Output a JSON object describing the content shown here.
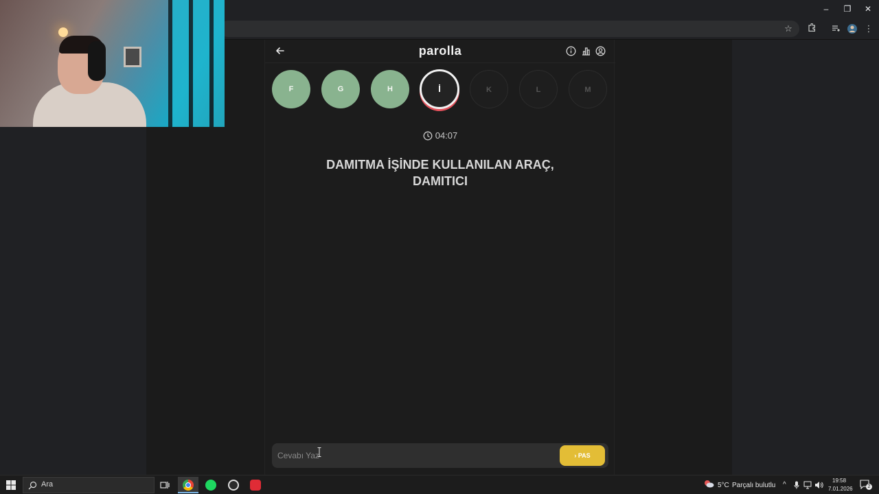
{
  "browser": {
    "window_controls": [
      "–",
      "❐",
      "✕"
    ]
  },
  "app": {
    "title": "parolla",
    "letters": [
      {
        "char": "F",
        "state": "done"
      },
      {
        "char": "G",
        "state": "done"
      },
      {
        "char": "H",
        "state": "done"
      },
      {
        "char": "İ",
        "state": "current"
      },
      {
        "char": "K",
        "state": "pending"
      },
      {
        "char": "L",
        "state": "pending"
      },
      {
        "char": "M",
        "state": "pending"
      }
    ],
    "timer": "04:07",
    "question_line1": "DAMITMA İŞİNDE KULLANILAN ARAÇ,",
    "question_line2": "DAMITICI",
    "answer_placeholder": "Cevabı Yaz",
    "pass_label": "PAS"
  },
  "colors": {
    "done": "#89b38f",
    "current_ring": "#e1505a",
    "pass_button": "#e3bd36"
  },
  "taskbar": {
    "search_placeholder": "Ara",
    "weather": "5°C",
    "weather_desc": "Parçalı bulutlu",
    "time": "19:58",
    "date": "7.01.2026",
    "notification_count": "2"
  }
}
